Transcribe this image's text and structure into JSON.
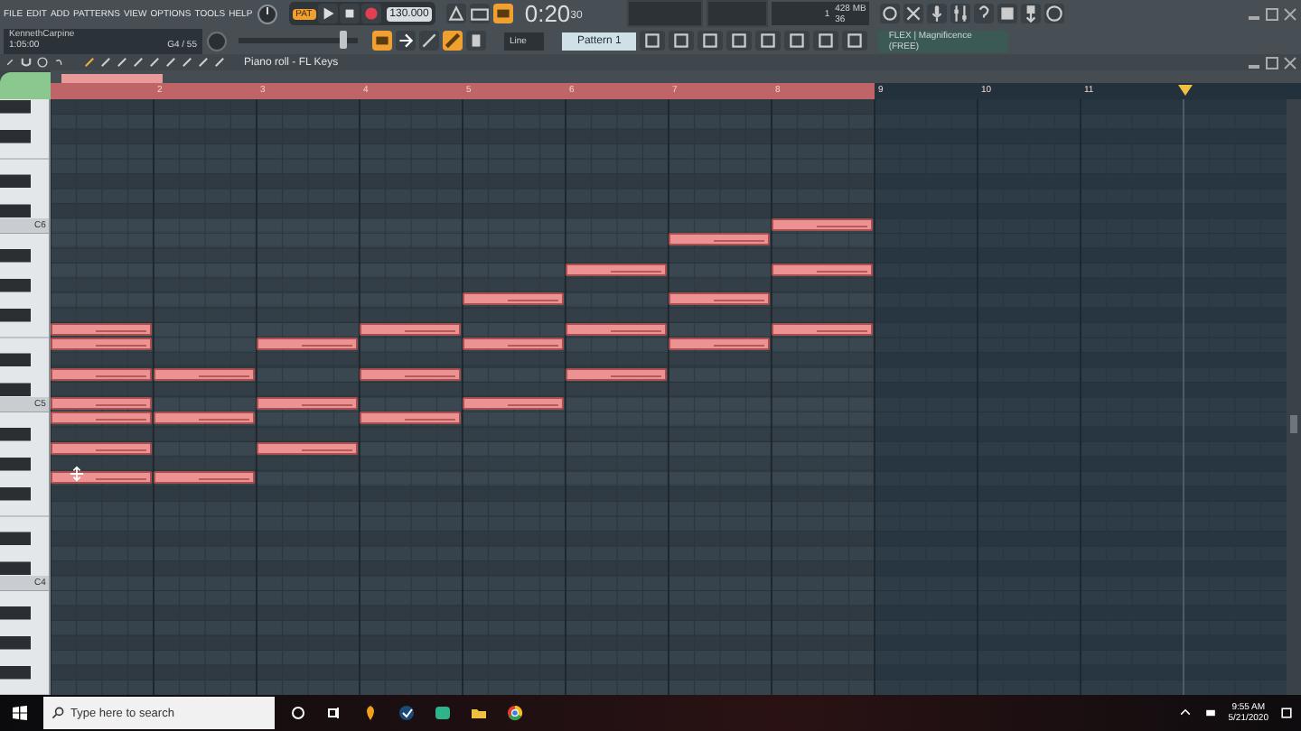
{
  "menu": [
    "FILE",
    "EDIT",
    "ADD",
    "PATTERNS",
    "VIEW",
    "OPTIONS",
    "TOOLS",
    "HELP"
  ],
  "transport": {
    "mode": "PAT",
    "tempo": "130.000",
    "time": "0:20",
    "time_small": "30",
    "cpu": "1",
    "memory": "428 MB",
    "polyphony": "36"
  },
  "hint_panel": {
    "title": "KennethCarpine",
    "time": "1:05:00",
    "note": "G4 / 55"
  },
  "master_volume": {
    "level": 0.9
  },
  "snap": "Line",
  "pattern": "Pattern 1",
  "news": {
    "title": "FLEX | Magnificence",
    "subtitle": "(FREE)"
  },
  "piano_roll": {
    "title": "Piano roll - FL Keys",
    "ruler": [
      "2",
      "3",
      "4",
      "5",
      "6",
      "7",
      "8",
      "9",
      "10",
      "11"
    ],
    "keys": [
      "C6",
      "C5",
      "C4"
    ],
    "note_rows": [
      {
        "cells": [
          false,
          false,
          false,
          false,
          false,
          false,
          false,
          true
        ]
      },
      {
        "cells": [
          false,
          false,
          false,
          false,
          false,
          false,
          true,
          false
        ]
      },
      {
        "cells": [
          false,
          false,
          false,
          false,
          false,
          false,
          false,
          false
        ]
      },
      {
        "cells": [
          false,
          false,
          false,
          false,
          false,
          true,
          false,
          true
        ]
      },
      {
        "cells": [
          false,
          false,
          false,
          false,
          false,
          false,
          false,
          false
        ]
      },
      {
        "cells": [
          false,
          false,
          false,
          false,
          true,
          false,
          true,
          false
        ]
      },
      {
        "cells": [
          false,
          false,
          false,
          false,
          false,
          false,
          false,
          false
        ]
      },
      {
        "cells": [
          true,
          false,
          false,
          true,
          false,
          true,
          false,
          true
        ]
      },
      {
        "cells": [
          true,
          false,
          true,
          false,
          true,
          false,
          true,
          false
        ]
      },
      {
        "cells": [
          false,
          false,
          false,
          false,
          false,
          false,
          false,
          false
        ]
      },
      {
        "cells": [
          true,
          true,
          false,
          true,
          false,
          true,
          false,
          false
        ]
      },
      {
        "cells": [
          false,
          false,
          false,
          false,
          false,
          false,
          false,
          false
        ]
      },
      {
        "cells": [
          true,
          false,
          true,
          false,
          true,
          false,
          false,
          false
        ]
      },
      {
        "cells": [
          true,
          true,
          false,
          true,
          false,
          false,
          false,
          false
        ]
      },
      {
        "cells": [
          false,
          false,
          false,
          false,
          false,
          false,
          false,
          false
        ]
      },
      {
        "cells": [
          true,
          false,
          true,
          false,
          false,
          false,
          false,
          false
        ]
      },
      {
        "cells": [
          false,
          false,
          false,
          false,
          false,
          false,
          false,
          false
        ]
      },
      {
        "cells": [
          true,
          true,
          false,
          false,
          false,
          false,
          false,
          false
        ]
      }
    ]
  },
  "taskbar": {
    "search_placeholder": "Type here to search",
    "time": "9:55 AM",
    "date": "5/21/2020"
  }
}
